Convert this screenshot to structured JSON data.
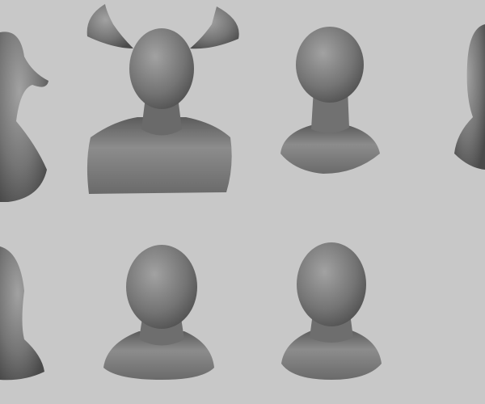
{
  "scene": {
    "background": "#c8c8c8",
    "bust_light": "#9a9a9a",
    "bust_dark": "#4a4a4a",
    "busts": [
      {
        "id": "creature-partial-left"
      },
      {
        "id": "horned-demon"
      },
      {
        "id": "female-head"
      },
      {
        "id": "partial-right"
      },
      {
        "id": "partial-bottom-left"
      },
      {
        "id": "male-head"
      },
      {
        "id": "old-man-head"
      }
    ]
  }
}
